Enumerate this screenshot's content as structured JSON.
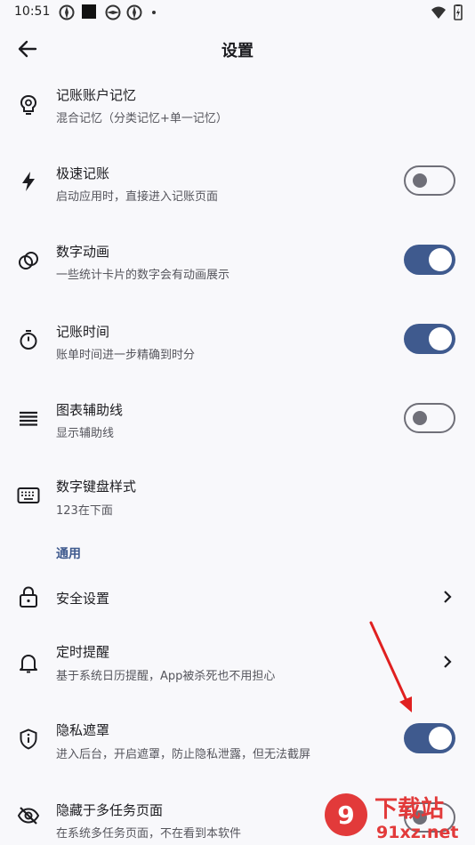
{
  "status_bar": {
    "time": "10:51"
  },
  "header": {
    "title": "设置"
  },
  "items": [
    {
      "title": "记账账户记忆",
      "subtitle": "混合记忆（分类记忆+单一记忆）",
      "icon": "brain-bulb-icon",
      "control": "none"
    },
    {
      "title": "极速记账",
      "subtitle": "启动应用时，直接进入记账页面",
      "icon": "lightning-icon",
      "control": "toggle",
      "on": false
    },
    {
      "title": "数字动画",
      "subtitle": "一些统计卡片的数字会有动画展示",
      "icon": "rings-icon",
      "control": "toggle",
      "on": true
    },
    {
      "title": "记账时间",
      "subtitle": "账单时间进一步精确到时分",
      "icon": "stopwatch-icon",
      "control": "toggle",
      "on": true
    },
    {
      "title": "图表辅助线",
      "subtitle": "显示辅助线",
      "icon": "lines-icon",
      "control": "toggle",
      "on": false
    },
    {
      "title": "数字键盘样式",
      "subtitle": "123在下面",
      "icon": "keyboard-icon",
      "control": "none"
    }
  ],
  "section_general": "通用",
  "general_items": [
    {
      "title": "安全设置",
      "icon": "lock-icon",
      "control": "chevron"
    },
    {
      "title": "定时提醒",
      "subtitle": "基于系统日历提醒，App被杀死也不用担心",
      "icon": "bell-icon",
      "control": "chevron"
    },
    {
      "title": "隐私遮罩",
      "subtitle": "进入后台，开启遮罩，防止隐私泄露，但无法截屏",
      "icon": "shield-icon",
      "control": "toggle",
      "on": true
    },
    {
      "title": "隐藏于多任务页面",
      "subtitle": "在系统多任务页面，不在看到本软件",
      "icon": "eye-off-icon",
      "control": "toggle",
      "on": false
    }
  ],
  "watermark": {
    "brand": "下载站",
    "url": "91xz.net"
  },
  "colors": {
    "accent": "#3f5a8e",
    "background": "#f8f8fb",
    "annotation_arrow": "#e02020"
  }
}
